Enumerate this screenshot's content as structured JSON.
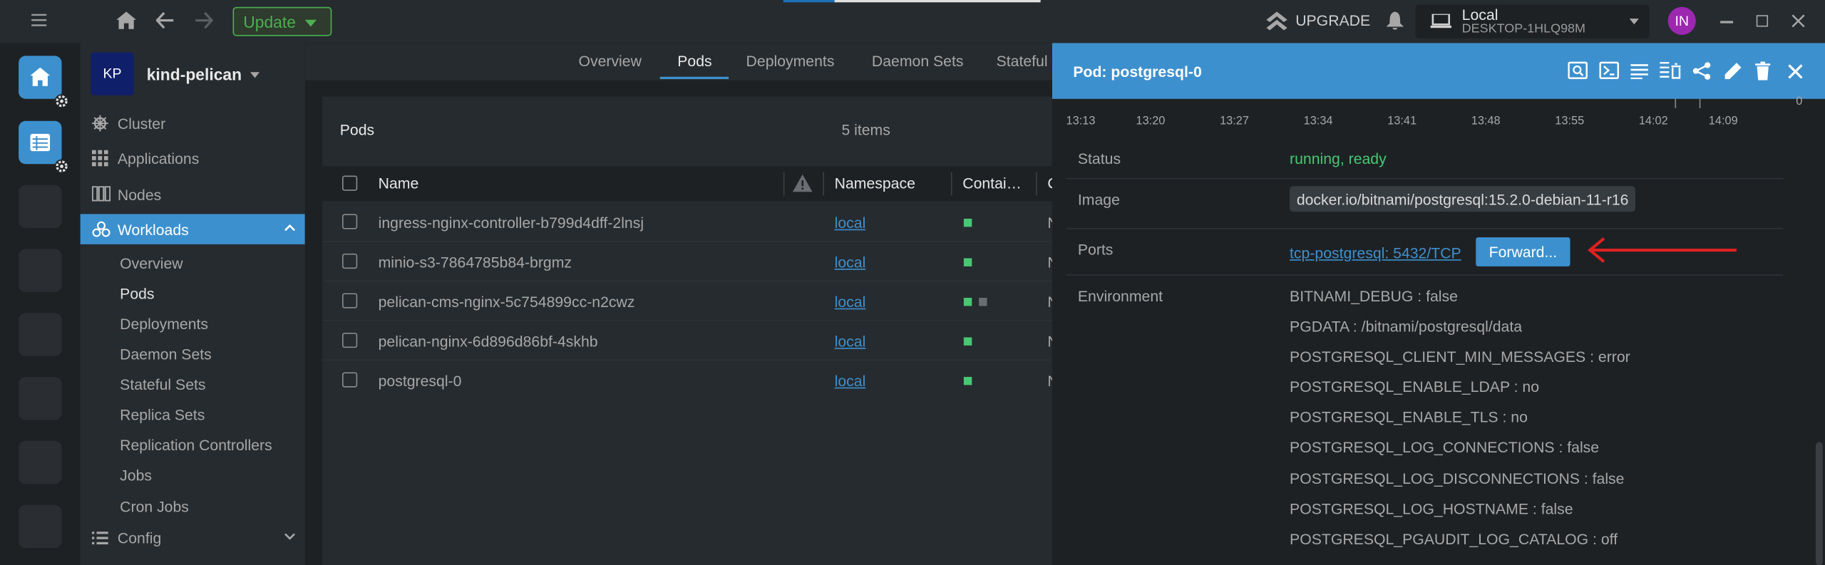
{
  "topbar": {
    "update_label": "Update",
    "upgrade_label": "UPGRADE",
    "cluster": {
      "name": "Local",
      "host": "DESKTOP-1HLQ98M"
    },
    "avatar_initials": "IN"
  },
  "sidebar": {
    "cluster_badge": "KP",
    "cluster_name": "kind-pelican",
    "items": [
      {
        "label": "Cluster",
        "icon": "helm-icon"
      },
      {
        "label": "Applications",
        "icon": "grid-icon"
      },
      {
        "label": "Nodes",
        "icon": "nodes-icon"
      },
      {
        "label": "Workloads",
        "icon": "workloads-icon"
      },
      {
        "label": "Config",
        "icon": "list-icon"
      }
    ],
    "workloads_sub": [
      "Overview",
      "Pods",
      "Deployments",
      "Daemon Sets",
      "Stateful Sets",
      "Replica Sets",
      "Replication Controllers",
      "Jobs",
      "Cron Jobs"
    ]
  },
  "tabs": [
    "Overview",
    "Pods",
    "Deployments",
    "Daemon Sets",
    "Stateful"
  ],
  "pods": {
    "title": "Pods",
    "count": "5 items",
    "columns": [
      "Name",
      "Namespace",
      "Contai…",
      "C"
    ],
    "rows": [
      {
        "name": "ingress-nginx-controller-b799d4dff-2lnsj",
        "namespace": "local",
        "containers": 1
      },
      {
        "name": "minio-s3-7864785b84-brgmz",
        "namespace": "local",
        "containers": 1
      },
      {
        "name": "pelican-cms-nginx-5c754899cc-n2cwz",
        "namespace": "local",
        "containers": 2
      },
      {
        "name": "pelican-nginx-6d896d86bf-4skhb",
        "namespace": "local",
        "containers": 1
      },
      {
        "name": "postgresql-0",
        "namespace": "local",
        "containers": 1
      }
    ]
  },
  "drawer": {
    "title": "Pod: postgresql-0",
    "timeline": [
      "13:13",
      "13:20",
      "13:27",
      "13:34",
      "13:41",
      "13:48",
      "13:55",
      "14:02",
      "14:09"
    ],
    "chart_corner_value": "0",
    "status_label": "Status",
    "status_value": "running, ready",
    "image_label": "Image",
    "image_value": "docker.io/bitnami/postgresql:15.2.0-debian-11-r16",
    "ports_label": "Ports",
    "port_value": "tcp-postgresql: 5432/TCP",
    "forward_label": "Forward...",
    "env_label": "Environment",
    "env": [
      "BITNAMI_DEBUG : false",
      "PGDATA : /bitnami/postgresql/data",
      "POSTGRESQL_CLIENT_MIN_MESSAGES : error",
      "POSTGRESQL_ENABLE_LDAP : no",
      "POSTGRESQL_ENABLE_TLS : no",
      "POSTGRESQL_LOG_CONNECTIONS : false",
      "POSTGRESQL_LOG_DISCONNECTIONS : false",
      "POSTGRESQL_LOG_HOSTNAME : false",
      "POSTGRESQL_PGAUDIT_LOG_CATALOG : off"
    ]
  },
  "colors": {
    "accent": "#3d90ce",
    "ok": "#48c774",
    "annotation": "#e02020"
  }
}
